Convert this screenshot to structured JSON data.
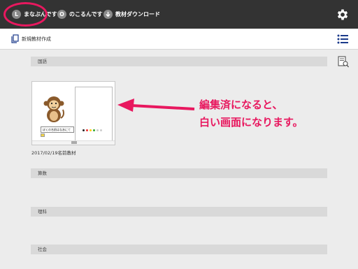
{
  "topbar": {
    "buttons": [
      {
        "badge": "L",
        "label": "まなぶんです"
      },
      {
        "badge": "O",
        "label": "のこるんです"
      },
      {
        "label": "教材ダウンロード"
      }
    ]
  },
  "toolbar": {
    "new_material_label": "新規教材作成"
  },
  "sections": [
    {
      "title": "国語"
    },
    {
      "title": "算数"
    },
    {
      "title": "理科"
    },
    {
      "title": "社会"
    }
  ],
  "material_card": {
    "text_box": "ぼくの名前はなあにて",
    "label": "2017/02/19名前教材"
  },
  "annotation": {
    "line1": "編集済になると、",
    "line2": "白い画面になります。",
    "color": "#e8185f"
  },
  "colors": {
    "topbar": "#333333",
    "accent": "#e8185f",
    "icon_blue": "#1a3a8a"
  }
}
